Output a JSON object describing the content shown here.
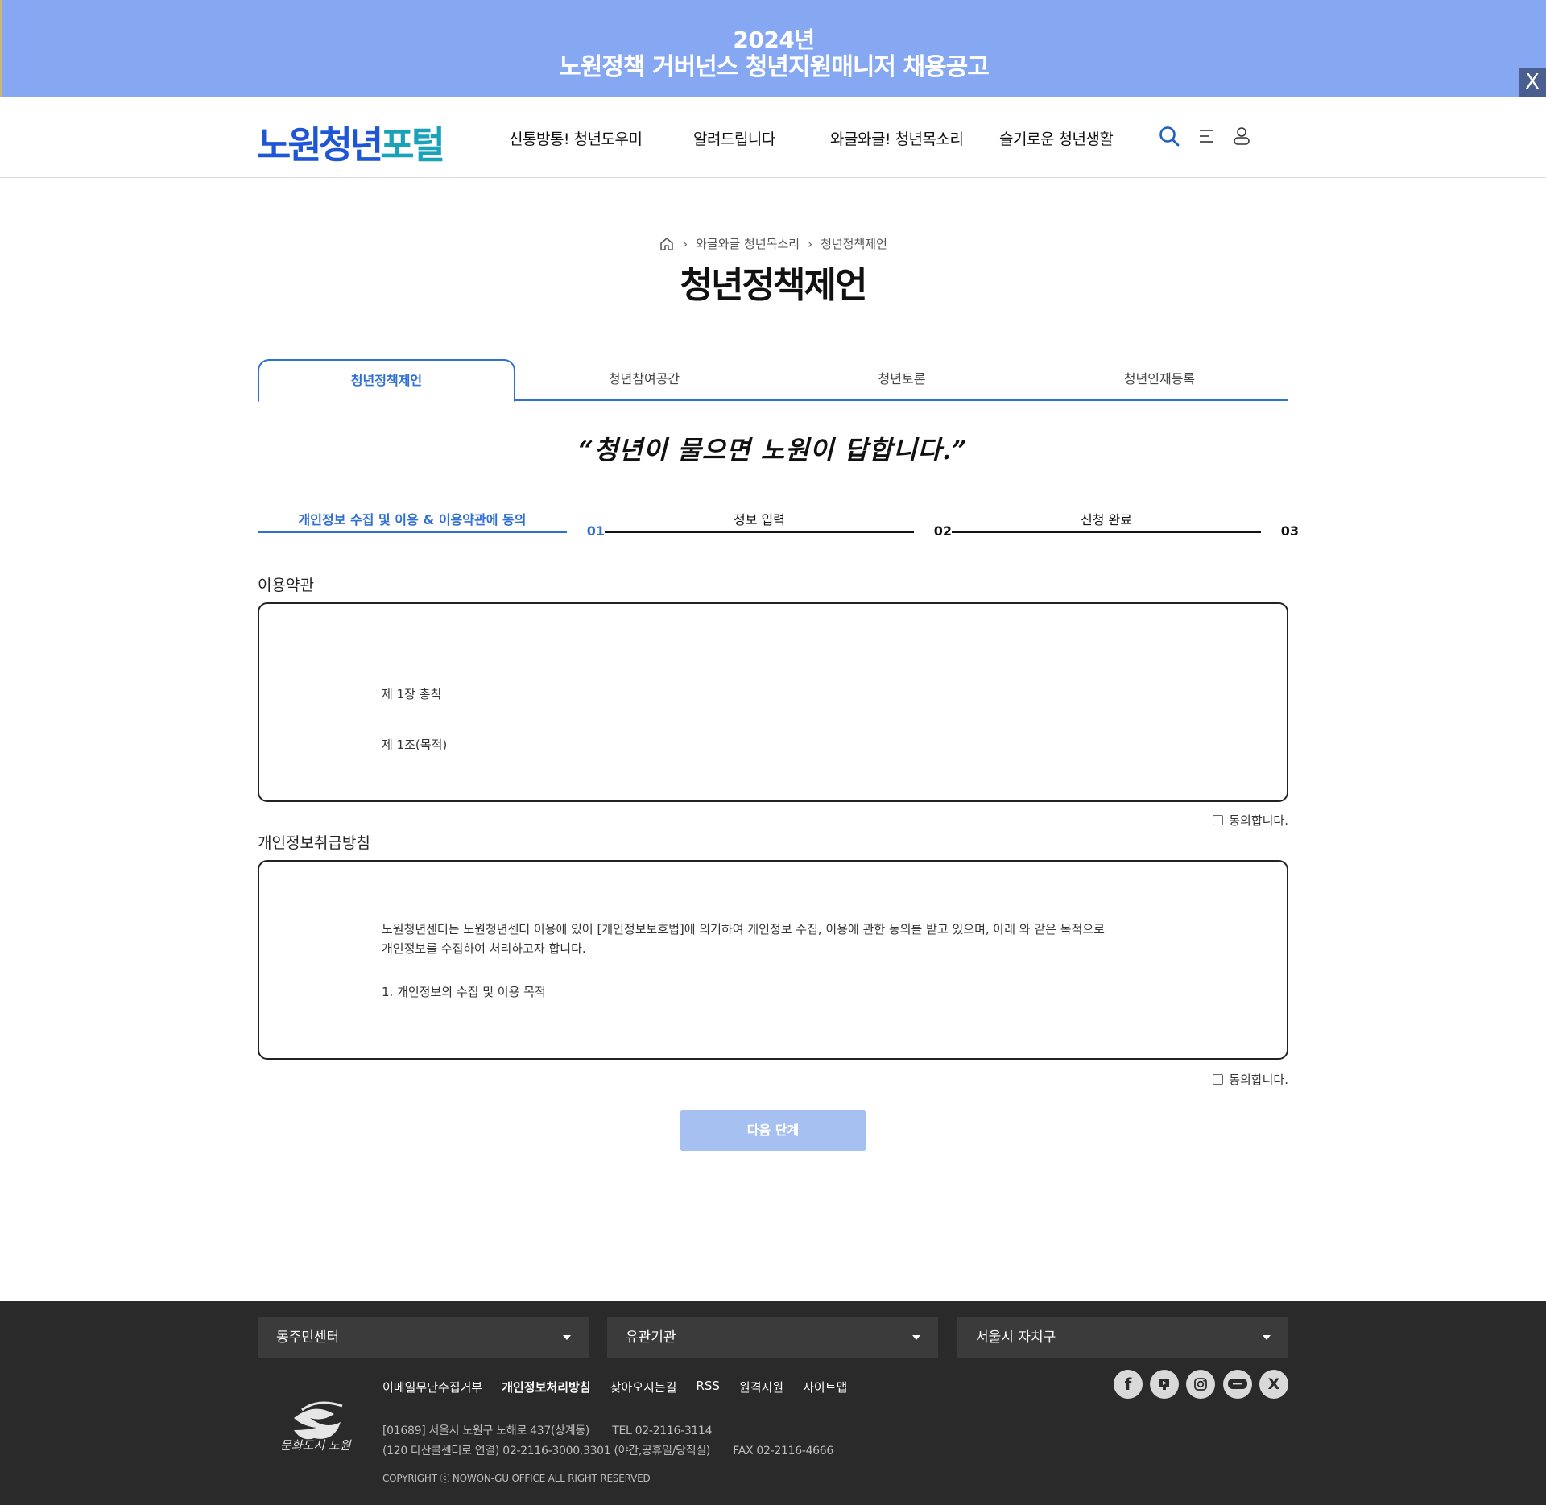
{
  "banner": {
    "year": "2024년",
    "title": "노원정책 거버넌스 청년지원매니저 채용공고",
    "close_label": "X"
  },
  "header": {
    "logo_main": "노원청년",
    "logo_accent": "포털",
    "nav": [
      "신통방통! 청년도우미",
      "알려드립니다",
      "와글와글! 청년목소리",
      "슬기로운 청년생활"
    ]
  },
  "breadcrumb": [
    "와글와글 청년목소리",
    "청년정책제언"
  ],
  "page_title": "청년정책제언",
  "tabs": [
    "청년정책제언",
    "청년참여공간",
    "청년토론",
    "청년인재등록"
  ],
  "slogan": "“청년이 물으면 노원이 답합니다.”",
  "steps": [
    {
      "label": "개인정보 수집 및 이용 & 이용약관에 동의",
      "num": "01"
    },
    {
      "label": "정보 입력",
      "num": "02"
    },
    {
      "label": "신청 완료",
      "num": "03"
    }
  ],
  "terms": {
    "title": "이용약관",
    "lines": [
      "제 1장 총칙",
      "제 1조(목적)"
    ],
    "agree": "동의합니다."
  },
  "privacy": {
    "title": "개인정보취급방침",
    "para1": "노원청년센터는 노원청년센터 이용에 있어 [개인정보보호법]에 의거하여 개인정보 수집, 이용에 관한 동의를 받고 있으며, 아래 와 같은 목적으로",
    "para2": "개인정보를 수집하여 처리하고자 합니다.",
    "item1": "1. 개인정보의 수집 및 이용 목적",
    "agree": "동의합니다."
  },
  "next_button": "다음 단계",
  "footer": {
    "selects": [
      "동주민센터",
      "유관기관",
      "서울시 자치구"
    ],
    "links": [
      "이메일무단수집거부",
      "개인정보처리방침",
      "찾아오시는길",
      "RSS",
      "원격지원",
      "사이트맵"
    ],
    "address": "[01689] 서울시 노원구 노해로 437(상계동)",
    "tel": "TEL 02-2116-3114",
    "night": "(120 다산콜센터로 연결) 02-2116-3000,3301 (야간,공휴일/당직실)",
    "fax": "FAX 02-2116-4666",
    "copyright": "COPYRIGHT ⓒ NOWON-GU OFFICE ALL RIGHT RESERVED",
    "logo_text": "문화도시 노원",
    "social": [
      "facebook-icon",
      "youtube-icon",
      "instagram-icon",
      "blog-icon",
      "x-icon"
    ]
  },
  "colors": {
    "banner_bg": "#86a8f3",
    "primary": "#2f6fd6",
    "logo_accent": "#1aa3b8",
    "button_disabled": "#a7c0f2",
    "footer_bg": "#2a2a2a"
  }
}
